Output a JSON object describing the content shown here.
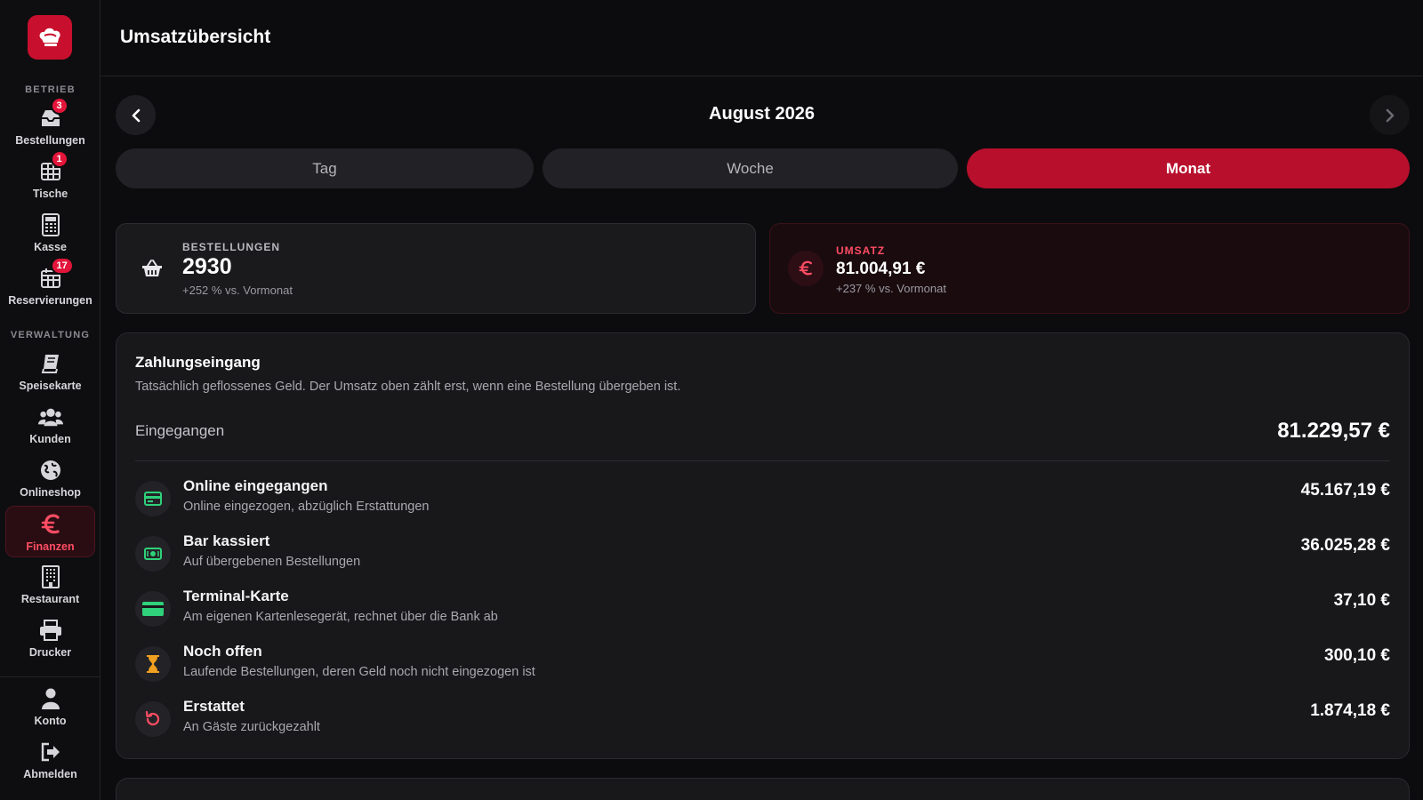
{
  "app": {
    "title": "Umsatzübersicht",
    "brand_color": "#c8102e"
  },
  "sidebar": {
    "section_operations": "BETRIEB",
    "section_admin": "VERWALTUNG",
    "items": [
      {
        "label": "Bestellungen",
        "icon": "inbox-icon",
        "badge": "3"
      },
      {
        "label": "Tische",
        "icon": "table-grid-icon",
        "badge": "1"
      },
      {
        "label": "Kasse",
        "icon": "calculator-icon"
      },
      {
        "label": "Reservierungen",
        "icon": "calendar-icon",
        "badge": "17"
      },
      {
        "label": "Speisekarte",
        "icon": "book-icon"
      },
      {
        "label": "Kunden",
        "icon": "users-icon"
      },
      {
        "label": "Onlineshop",
        "icon": "globe-icon"
      },
      {
        "label": "Finanzen",
        "icon": "euro-icon",
        "active": true
      },
      {
        "label": "Restaurant",
        "icon": "building-icon"
      },
      {
        "label": "Drucker",
        "icon": "printer-icon"
      },
      {
        "label": "Konto",
        "icon": "user-icon"
      },
      {
        "label": "Abmelden",
        "icon": "logout-icon"
      }
    ]
  },
  "period": {
    "label": "August 2026",
    "tabs": [
      {
        "label": "Tag"
      },
      {
        "label": "Woche"
      },
      {
        "label": "Monat",
        "active": true
      }
    ]
  },
  "stats": {
    "orders": {
      "label": "BESTELLUNGEN",
      "value": "2930",
      "change": "+252 % vs. Vormonat"
    },
    "revenue": {
      "label": "UMSATZ",
      "value": "81.004,91 €",
      "change": "+237 % vs. Vormonat"
    }
  },
  "payments": {
    "title": "Zahlungseingang",
    "description": "Tatsächlich geflossenes Geld. Der Umsatz oben zählt erst, wenn eine Bestellung übergeben ist.",
    "total_label": "Eingegangen",
    "total_value": "81.229,57 €",
    "rows": [
      {
        "title": "Online eingegangen",
        "subtitle": "Online eingezogen, abzüglich Erstattungen",
        "amount": "45.167,19 €",
        "icon": "credit-card-icon",
        "color": "#2fd17a"
      },
      {
        "title": "Bar kassiert",
        "subtitle": "Auf übergebenen Bestellungen",
        "amount": "36.025,28 €",
        "icon": "banknote-icon",
        "color": "#2fd17a"
      },
      {
        "title": "Terminal-Karte",
        "subtitle": "Am eigenen Kartenlesegerät, rechnet über die Bank ab",
        "amount": "37,10 €",
        "icon": "card-terminal-icon",
        "color": "#2fd17a"
      },
      {
        "title": "Noch offen",
        "subtitle": "Laufende Bestellungen, deren Geld noch nicht eingezogen ist",
        "amount": "300,10 €",
        "icon": "hourglass-icon",
        "color": "#f0a020"
      },
      {
        "title": "Erstattet",
        "subtitle": "An Gäste zurückgezahlt",
        "amount": "1.874,18 €",
        "icon": "refund-icon",
        "color": "#ff4d63"
      }
    ]
  }
}
